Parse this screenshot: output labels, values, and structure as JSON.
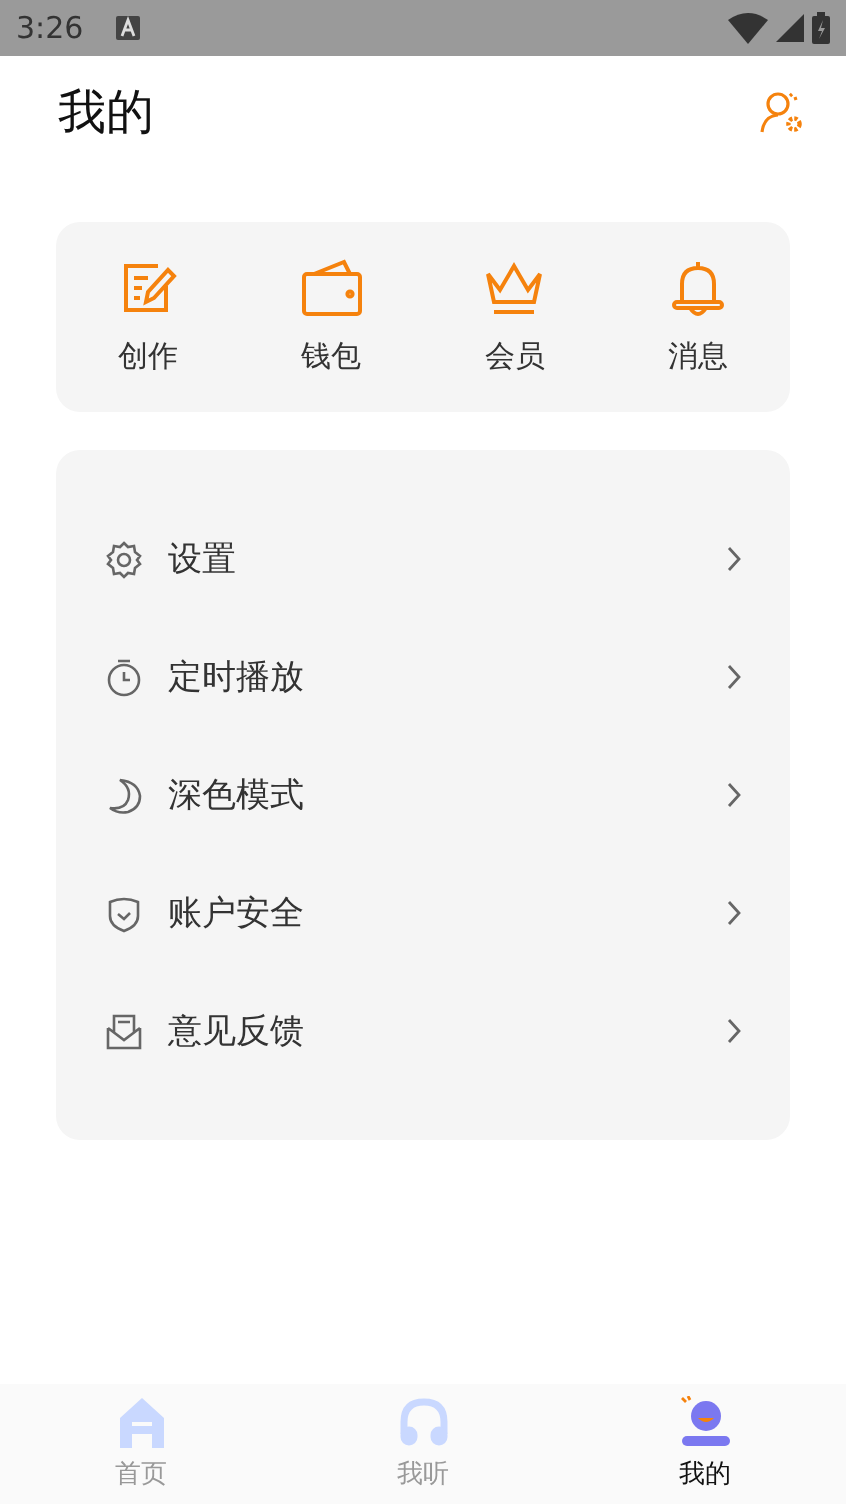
{
  "status_bar": {
    "time": "3:26"
  },
  "header": {
    "title": "我的"
  },
  "quick_actions": [
    {
      "kind": "edit",
      "label": "创作"
    },
    {
      "kind": "wallet",
      "label": "钱包"
    },
    {
      "kind": "crown",
      "label": "会员"
    },
    {
      "kind": "bell",
      "label": "消息"
    }
  ],
  "menu": [
    {
      "kind": "gear",
      "label": "设置"
    },
    {
      "kind": "timer",
      "label": "定时播放"
    },
    {
      "kind": "moon",
      "label": "深色模式"
    },
    {
      "kind": "shield",
      "label": "账户安全"
    },
    {
      "kind": "mail",
      "label": "意见反馈"
    }
  ],
  "tabs": [
    {
      "kind": "home",
      "label": "首页",
      "selected": false
    },
    {
      "kind": "listen",
      "label": "我听",
      "selected": false
    },
    {
      "kind": "me",
      "label": "我的",
      "selected": true
    }
  ]
}
